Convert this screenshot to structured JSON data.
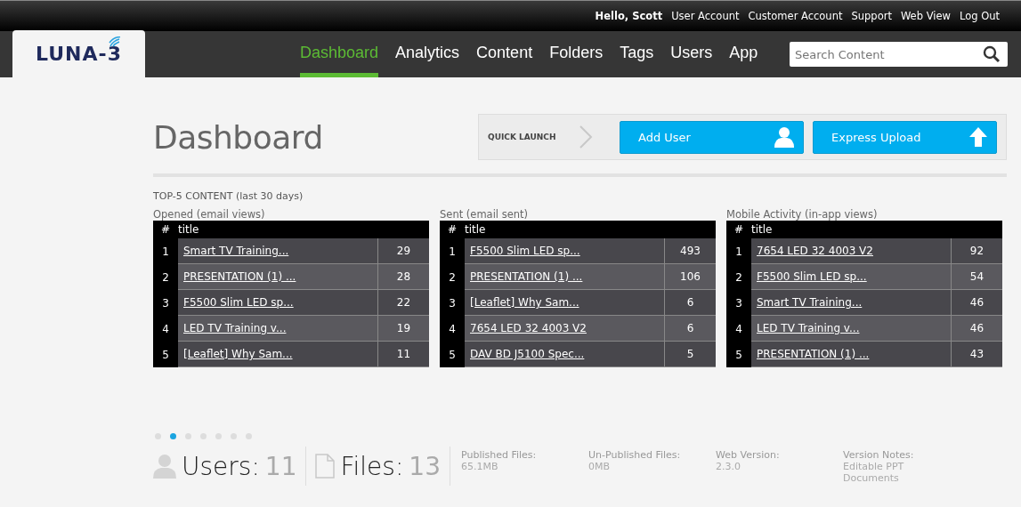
{
  "top_bar": {
    "greeting": "Hello, Scott",
    "links": [
      "User Account",
      "Customer Account",
      "Support",
      "Web View",
      "Log Out"
    ]
  },
  "logo": {
    "text": "LUNA-3"
  },
  "nav": [
    {
      "label": "Dashboard",
      "selected": true
    },
    {
      "label": "Analytics",
      "selected": false
    },
    {
      "label": "Content",
      "selected": false
    },
    {
      "label": "Folders",
      "selected": false
    },
    {
      "label": "Tags",
      "selected": false
    },
    {
      "label": "Users",
      "selected": false
    },
    {
      "label": "App",
      "selected": false
    }
  ],
  "search": {
    "placeholder": "Search Content"
  },
  "page_title": "Dashboard",
  "quick_launch": {
    "label": "QUICK LAUNCH",
    "buttons": [
      {
        "label": "Add User",
        "kind": "user"
      },
      {
        "label": "Express Upload",
        "kind": "upload"
      }
    ]
  },
  "section_label": "TOP-5 CONTENT (last 30 days)",
  "tables": [
    {
      "caption": "Opened (email views)",
      "columns": [
        "#",
        "title"
      ],
      "rows": [
        {
          "rank": "1",
          "title": "Smart TV Training...",
          "count": "29"
        },
        {
          "rank": "2",
          "title": "PRESENTATION (1) ...",
          "count": "28"
        },
        {
          "rank": "3",
          "title": "F5500 Slim LED sp...",
          "count": "22"
        },
        {
          "rank": "4",
          "title": "LED TV Training v...",
          "count": "19"
        },
        {
          "rank": "5",
          "title": "[Leaflet] Why Sam...",
          "count": "11"
        }
      ]
    },
    {
      "caption": "Sent (email sent)",
      "columns": [
        "#",
        "title"
      ],
      "rows": [
        {
          "rank": "1",
          "title": "F5500 Slim LED sp...",
          "count": "493"
        },
        {
          "rank": "2",
          "title": "PRESENTATION (1) ...",
          "count": "106"
        },
        {
          "rank": "3",
          "title": "[Leaflet] Why Sam...",
          "count": "6"
        },
        {
          "rank": "4",
          "title": "7654 LED 32 4003 V2",
          "count": "6"
        },
        {
          "rank": "5",
          "title": "DAV BD J5100 Spec...",
          "count": "5"
        }
      ]
    },
    {
      "caption": "Mobile Activity (in-app views)",
      "columns": [
        "#",
        "title"
      ],
      "rows": [
        {
          "rank": "1",
          "title": "7654 LED 32 4003 V2",
          "count": "92"
        },
        {
          "rank": "2",
          "title": "F5500 Slim LED sp...",
          "count": "54"
        },
        {
          "rank": "3",
          "title": "Smart TV Training...",
          "count": "46"
        },
        {
          "rank": "4",
          "title": "LED TV Training v...",
          "count": "46"
        },
        {
          "rank": "5",
          "title": "PRESENTATION (1) ...",
          "count": "43"
        }
      ]
    }
  ],
  "pager": [
    {
      "selected": false
    },
    {
      "selected": true
    },
    {
      "selected": false
    },
    {
      "selected": false
    },
    {
      "selected": false
    },
    {
      "selected": false
    },
    {
      "selected": false
    }
  ],
  "counters": [
    {
      "kind": "user",
      "label": "Users:",
      "value": "11"
    },
    {
      "kind": "file",
      "label": "Files:",
      "value": "13"
    }
  ],
  "stats": [
    {
      "label": "Published Files:",
      "value": "65.1MB"
    },
    {
      "label": "Un-Published Files:",
      "value": "0MB"
    },
    {
      "label": "Web Version:",
      "value": "2.3.0"
    },
    {
      "label": "Version Notes:",
      "value": "Editable PPT Documents"
    }
  ]
}
